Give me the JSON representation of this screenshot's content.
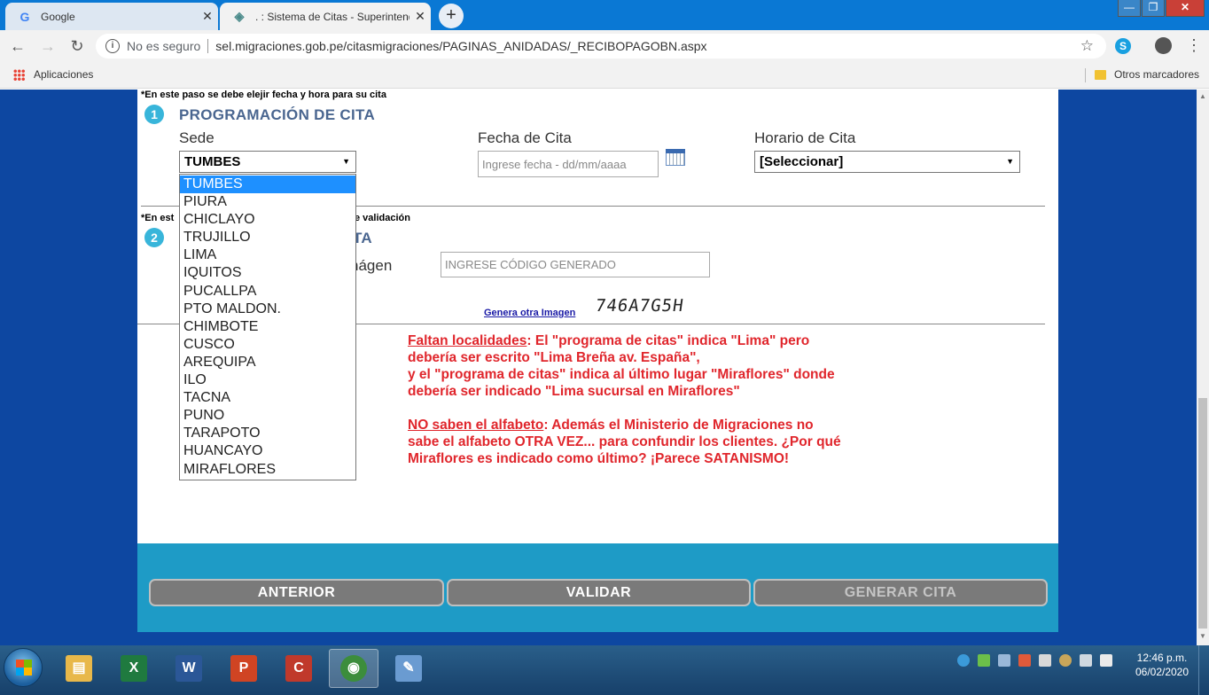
{
  "browser": {
    "tabs": [
      {
        "label": "Google",
        "active": false
      },
      {
        "label": ". : Sistema de Citas - Superintend",
        "active": true
      }
    ],
    "new_tab_label": "+",
    "window_controls": {
      "minimize": "—",
      "maximize": "❐",
      "close": "✕"
    },
    "security_label": "No es seguro",
    "url": "sel.migraciones.gob.pe/citasmigraciones/PAGINAS_ANIDADAS/_RECIBOPAGOBN.aspx",
    "bookmarks": {
      "apps_label": "Aplicaciones",
      "others_label": "Otros marcadores"
    }
  },
  "page": {
    "step1_note": "*En este paso se debe elejir fecha y hora para su cita",
    "step1_number": "1",
    "step1_title": "PROGRAMACIÓN DE CITA",
    "sede_label": "Sede",
    "sede_selected": "TUMBES",
    "fecha_label": "Fecha de Cita",
    "fecha_placeholder": "Ingrese fecha - dd/mm/aaaa",
    "horario_label": "Horario de Cita",
    "horario_selected": "[Seleccionar]",
    "step2_note_start": "*En est",
    "step2_note_end": "e validación",
    "step2_number": "2",
    "step2_title_tail": "TA",
    "captcha_label_tail": "nágen",
    "captcha_placeholder": "INGRESE CÓDIGO GENERADO",
    "genera_link": "Genera otra Imagen",
    "captcha_text": "746A7G5H",
    "sede_options": [
      "TUMBES",
      "PIURA",
      "CHICLAYO",
      "TRUJILLO",
      "LIMA",
      "IQUITOS",
      "PUCALLPA",
      "PTO MALDON.",
      "CHIMBOTE",
      "CUSCO",
      "AREQUIPA",
      "ILO",
      "TACNA",
      "PUNO",
      "TARAPOTO",
      "HUANCAYO",
      "MIRAFLORES"
    ],
    "annotation": {
      "p1_heading": "Faltan localidades",
      "p1_body_1": ": El \"programa de citas\" indica \"Lima\" pero",
      "p1_body_2": "debería ser escrito \"Lima Breña av. España\",",
      "p1_body_3": "y el \"programa de citas\" indica al último lugar \"Miraflores\" donde",
      "p1_body_4": "debería ser indicado \"Lima sucursal en Miraflores\"",
      "p2_heading": "NO saben el alfabeto",
      "p2_body_1": ": Además el Ministerio de Migraciones no",
      "p2_body_2": "sabe el alfabeto OTRA VEZ... para confundir los clientes. ¿Por qué",
      "p2_body_3": "Miraflores es indicado como último? ¡Parece SATANISMO!"
    },
    "buttons": {
      "anterior": "ANTERIOR",
      "validar": "VALIDAR",
      "generar": "GENERAR CITA"
    }
  },
  "taskbar": {
    "apps": [
      {
        "name": "explorer",
        "glyph": "▤",
        "color": "#e8b84a"
      },
      {
        "name": "excel",
        "glyph": "X",
        "color": "#1f7a3f"
      },
      {
        "name": "word",
        "glyph": "W",
        "color": "#2b5797"
      },
      {
        "name": "powerpoint",
        "glyph": "P",
        "color": "#d04423"
      },
      {
        "name": "ccleaner",
        "glyph": "C",
        "color": "#c0392b"
      },
      {
        "name": "chrome",
        "glyph": "◉",
        "color": "#3c8d3c"
      },
      {
        "name": "paint",
        "glyph": "✎",
        "color": "#6a9bd1"
      }
    ],
    "time": "12:46 p.m.",
    "date": "06/02/2020"
  }
}
